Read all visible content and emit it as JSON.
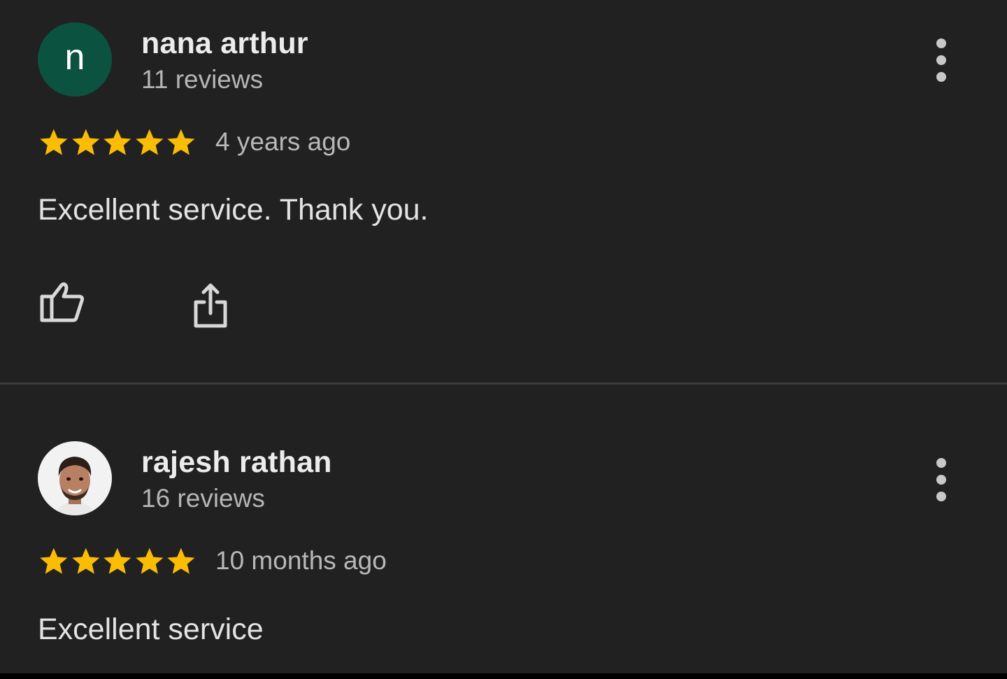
{
  "reviews": [
    {
      "author": "nana arthur",
      "avatar_letter": "n",
      "avatar_color": "#0c5240",
      "review_count": "11 reviews",
      "rating": 5,
      "rating_max": 5,
      "time": "4 years ago",
      "text": "Excellent service. Thank you.",
      "actions": [
        "thumbs-up-icon",
        "share-icon"
      ],
      "menu_icon": "more-vert-icon"
    },
    {
      "author": "rajesh rathan",
      "avatar": "profile-photo",
      "review_count": "16 reviews",
      "rating": 5,
      "rating_max": 5,
      "time": "10 months ago",
      "text": "Excellent service",
      "menu_icon": "more-vert-icon"
    }
  ],
  "colors": {
    "background": "#212121",
    "star": "#fbbc04",
    "divider": "#3c3c3c"
  }
}
